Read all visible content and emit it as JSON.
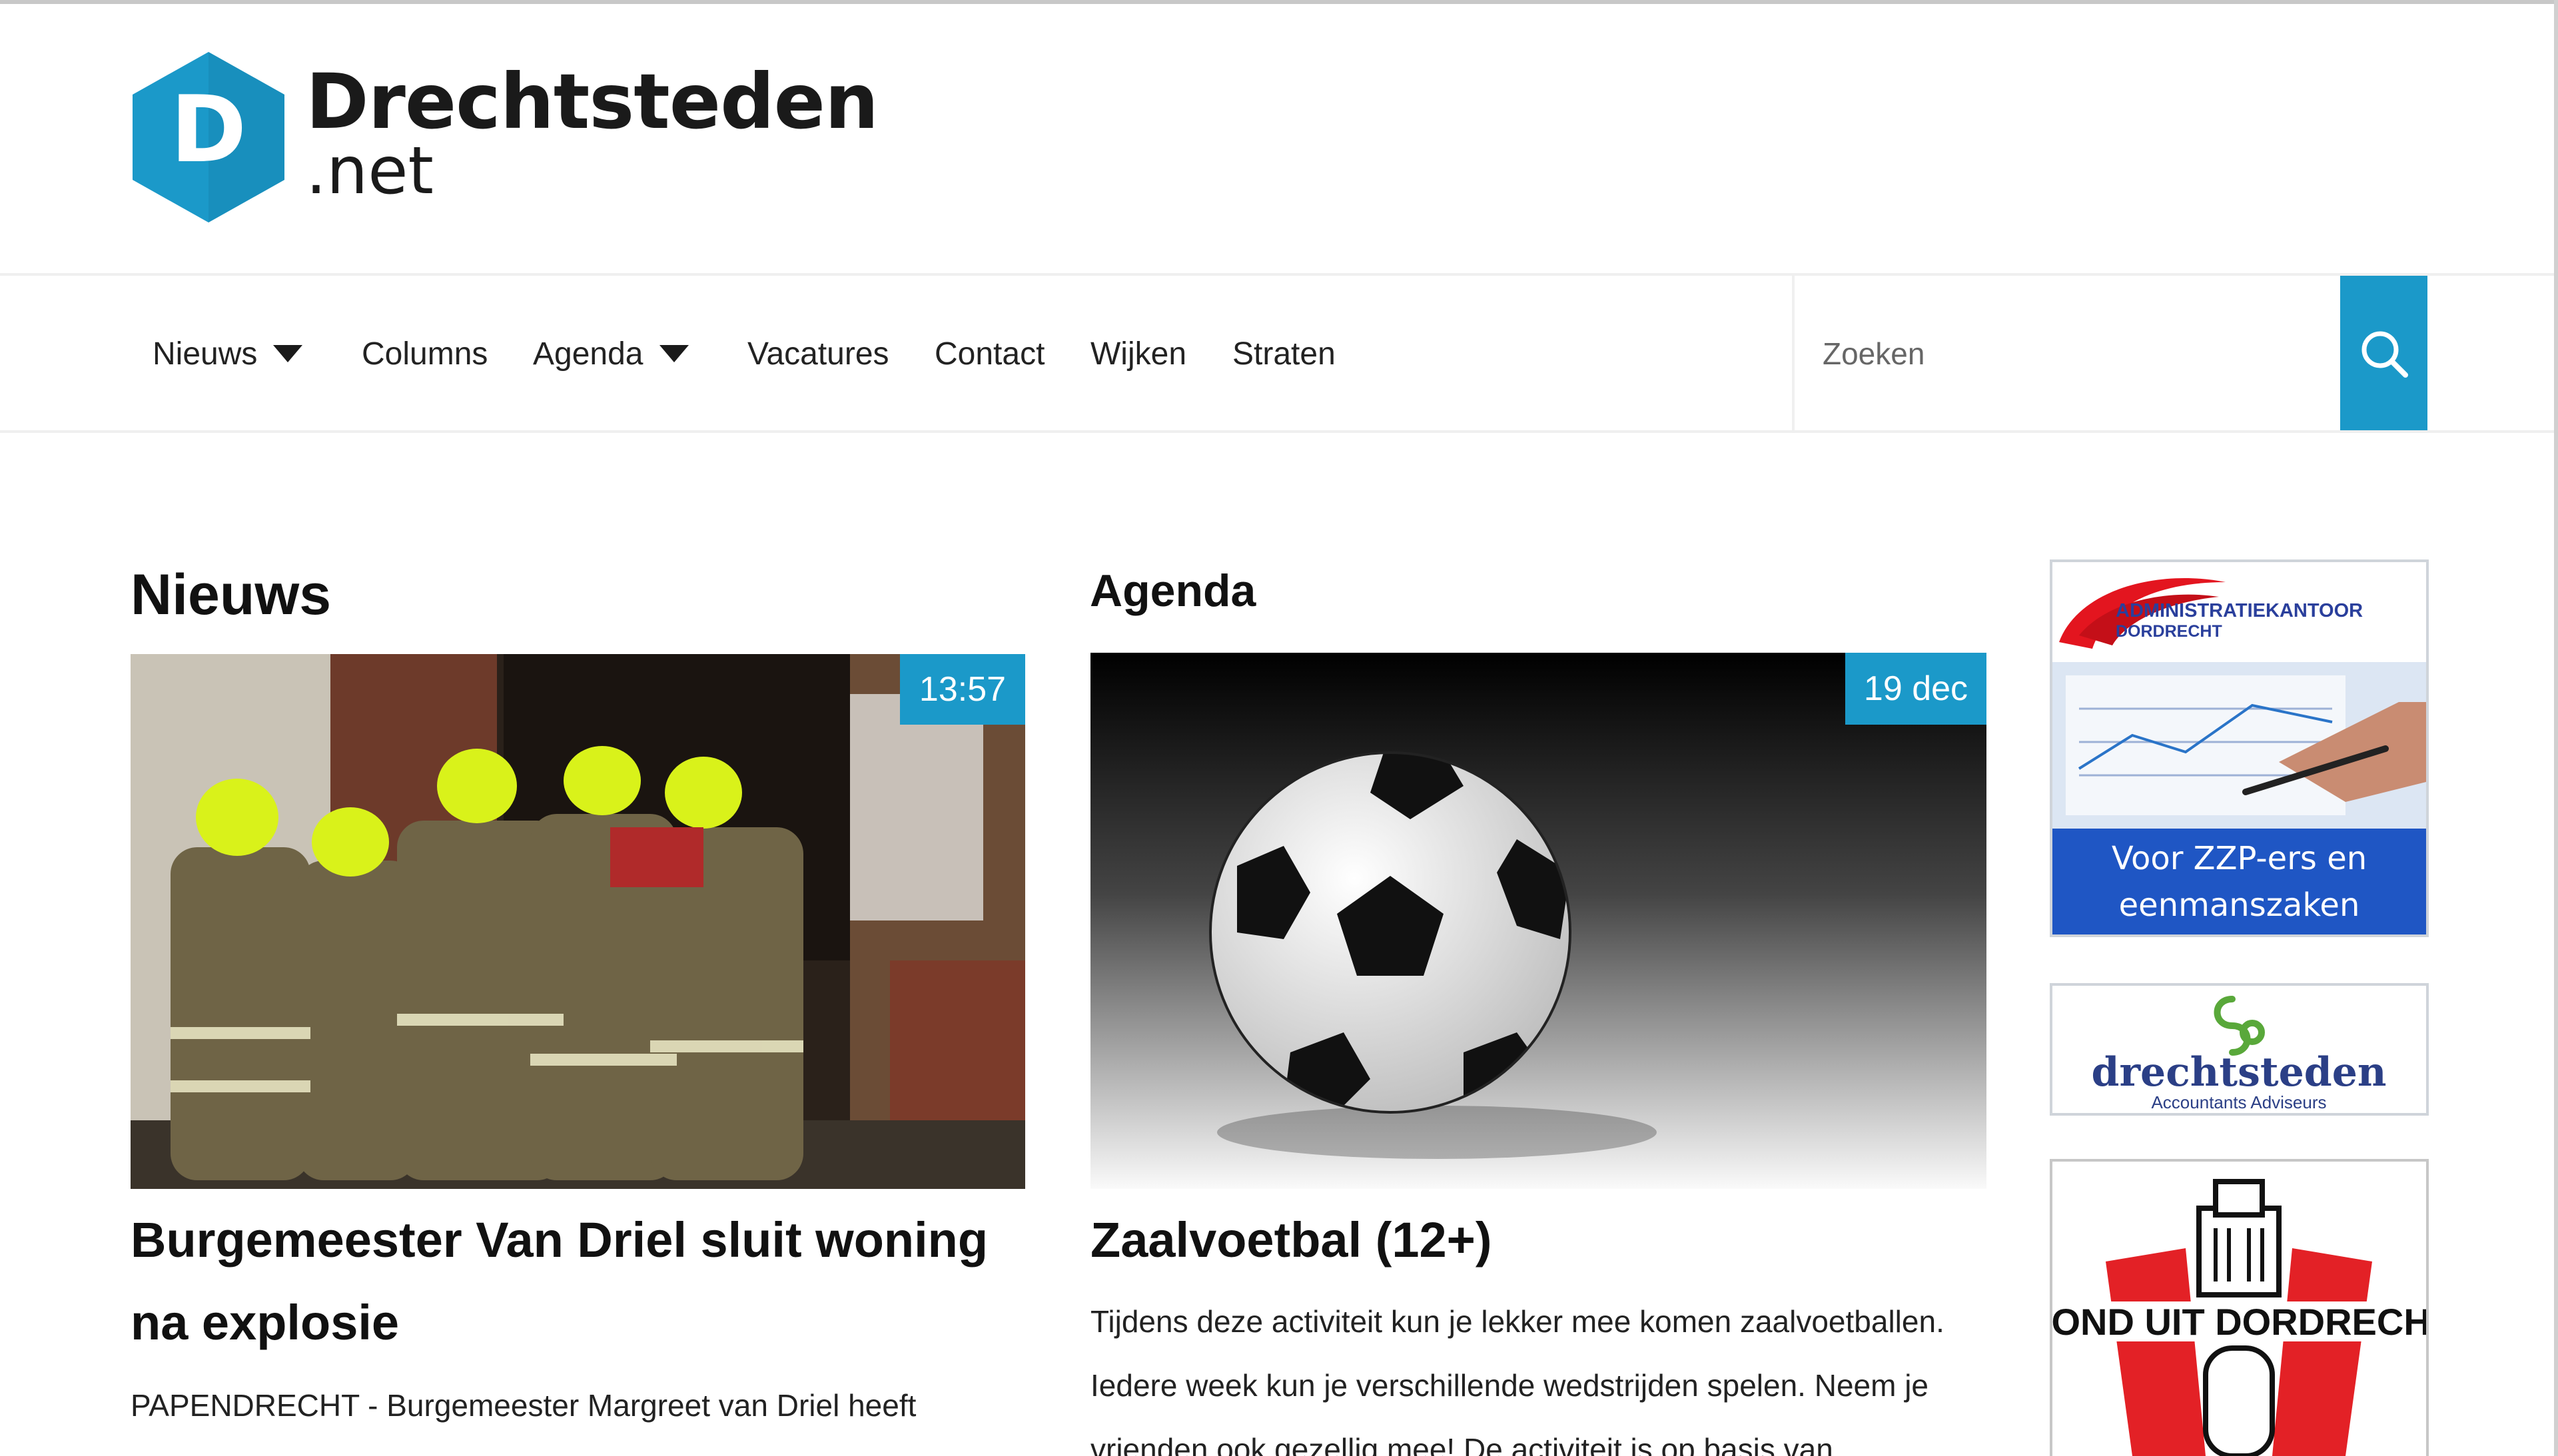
{
  "brand": {
    "name": "Drechtsteden",
    "tld": ".net",
    "logo_letter": "D",
    "logo_color": "#1b99c9"
  },
  "nav": {
    "items": [
      {
        "label": "Nieuws",
        "has_dropdown": true
      },
      {
        "label": "Columns",
        "has_dropdown": false
      },
      {
        "label": "Agenda",
        "has_dropdown": true
      },
      {
        "label": "Vacatures",
        "has_dropdown": false
      },
      {
        "label": "Contact",
        "has_dropdown": false
      },
      {
        "label": "Wijken",
        "has_dropdown": false
      },
      {
        "label": "Straten",
        "has_dropdown": false
      }
    ],
    "search": {
      "placeholder": "Zoeken",
      "value": "",
      "icon": "search-icon"
    },
    "accent": "#1b99c9"
  },
  "news": {
    "section_title": "Nieuws",
    "time_badge": "13:57",
    "image": "firefighters-at-burnt-house",
    "headline": "Burgemeester Van Driel sluit woning na explosie",
    "excerpt": "PAPENDRECHT - Burgemeester Margreet van Driel heeft"
  },
  "agenda": {
    "section_title": "Agenda",
    "date_badge": "19 dec",
    "image": "soccer-ball",
    "headline": "Zaalvoetbal (12+)",
    "excerpt": "Tijdens deze activiteit kun je lekker mee komen zaalvoetballen. Iedere week kun je verschillende wedstrijden spelen. Neem je vrienden ook gezellig mee! De activiteit is op basis van"
  },
  "ads": [
    {
      "brand_line1": "ADMINISTRATIEKANTOOR",
      "brand_line2": "DORDRECHT",
      "tagline": "Voor ZZP-ers en eenmanszaken",
      "color": "#1f56c4"
    },
    {
      "brand": "drechtsteden",
      "sub": "Accountants Adviseurs",
      "color": "#2b3f86",
      "leaf_color": "#59a83a"
    },
    {
      "title": "ROND UIT DORDRECHT",
      "color": "#e32126"
    }
  ]
}
